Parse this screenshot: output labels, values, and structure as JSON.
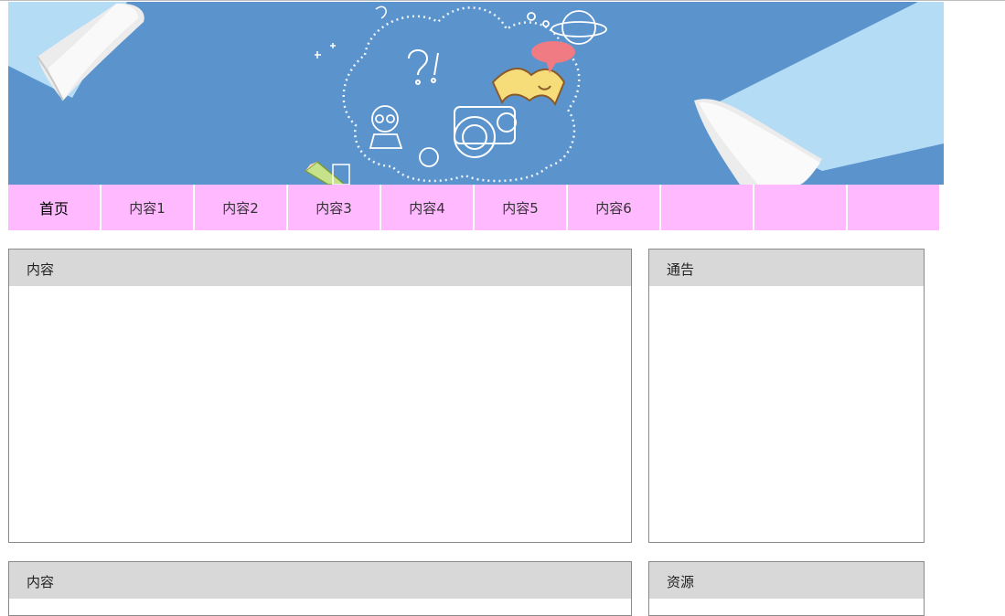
{
  "nav": {
    "items": [
      {
        "label": "首页"
      },
      {
        "label": "内容1"
      },
      {
        "label": "内容2"
      },
      {
        "label": "内容3"
      },
      {
        "label": "内容4"
      },
      {
        "label": "内容5"
      },
      {
        "label": "内容6"
      },
      {
        "label": ""
      },
      {
        "label": ""
      },
      {
        "label": ""
      }
    ]
  },
  "panels": {
    "content_main": {
      "title": "内容"
    },
    "notice": {
      "title": "通告"
    },
    "content_second": {
      "title": "内容"
    },
    "resources": {
      "title": "资源"
    }
  },
  "banner": {
    "colors": {
      "background": "#5b93cd",
      "paper": "#b5dcf5",
      "curl": "#e8e8e8"
    },
    "icons": [
      "paper-curl-icon",
      "question-mark-icon",
      "camera-icon",
      "book-icon",
      "speech-bubble-icon",
      "planet-icon",
      "student-icon",
      "pencil-icon"
    ]
  },
  "colors": {
    "nav_background": "#ffb9ff",
    "panel_header": "#d8d8d8",
    "panel_border": "#8a8a8a"
  }
}
